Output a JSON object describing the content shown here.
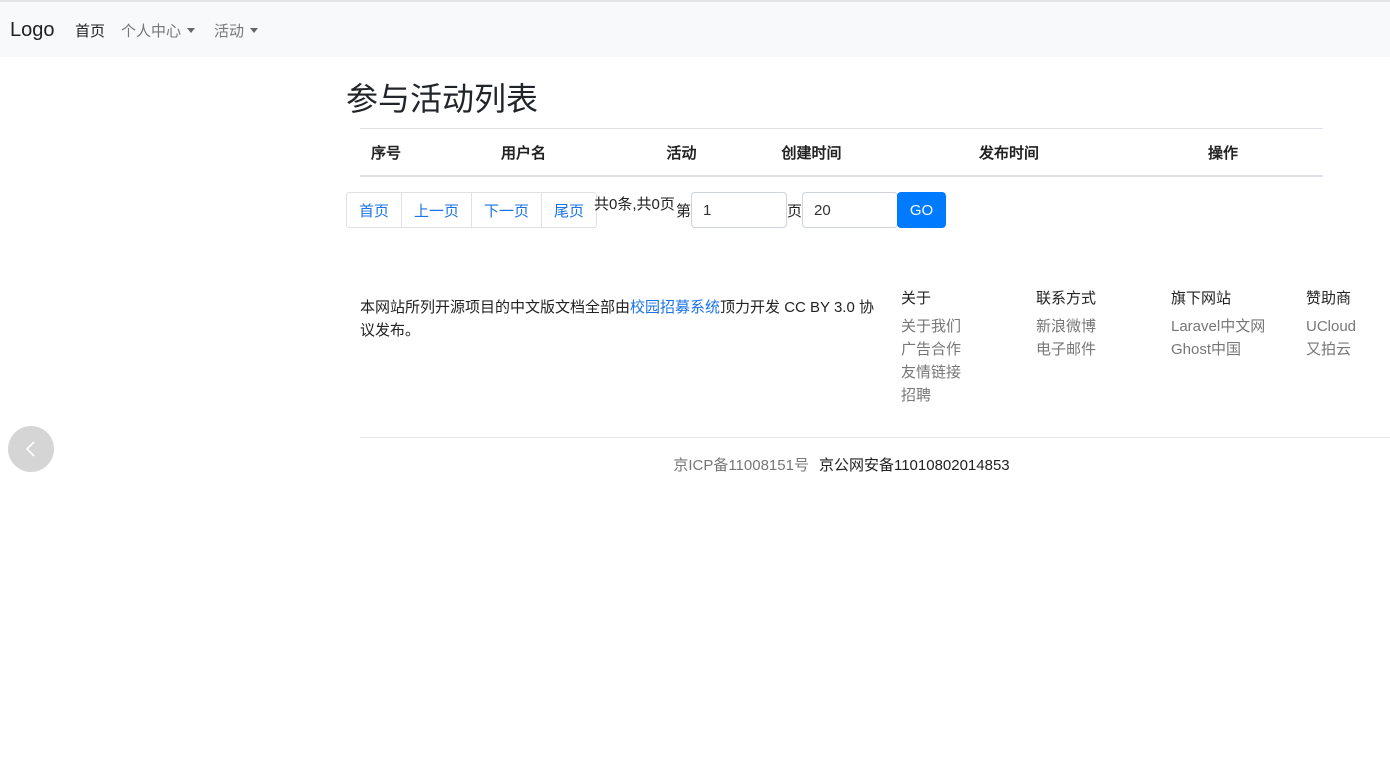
{
  "navbar": {
    "brand": "Logo",
    "items": [
      {
        "label": "首页"
      },
      {
        "label": "个人中心"
      },
      {
        "label": "活动"
      }
    ]
  },
  "page": {
    "title": "参与活动列表"
  },
  "table": {
    "headers": [
      "序号",
      "用户名",
      "活动",
      "创建时间",
      "发布时间",
      "操作"
    ],
    "rows": []
  },
  "pagination": {
    "first": "首页",
    "prev": "上一页",
    "next": "下一页",
    "last": "尾页",
    "summary": "共0条,共0页",
    "page_prefix": "第",
    "page_value": "1",
    "page_suffix": "页",
    "size_value": "20",
    "go": "GO"
  },
  "footer": {
    "desc_before": "本网站所列开源项目的中文版文档全部由",
    "desc_link": "校园招募系统",
    "desc_after": "顶力开发 CC BY 3.0 协议发布。",
    "columns": [
      {
        "heading": "关于",
        "links": [
          "关于我们",
          "广告合作",
          "友情链接",
          "招聘"
        ]
      },
      {
        "heading": "联系方式",
        "links": [
          "新浪微博",
          "电子邮件"
        ]
      },
      {
        "heading": "旗下网站",
        "links": [
          "Laravel中文网",
          "Ghost中国"
        ]
      },
      {
        "heading": "赞助商",
        "links": [
          "UCloud",
          "又拍云"
        ]
      }
    ],
    "icp": "京ICP备11008151号",
    "police": "京公网安备11010802014853"
  },
  "colors": {
    "primary": "#007bff",
    "link": "#1a73e8",
    "navbar_bg": "#f8f9fa"
  },
  "icons": {
    "back": "chevron-left-icon"
  }
}
